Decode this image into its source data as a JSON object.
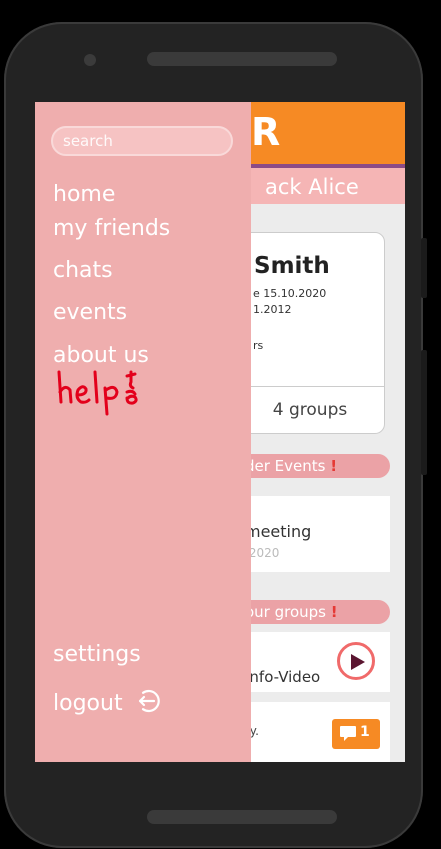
{
  "app": {
    "logo_letter": "R",
    "welcome_text": "ack Alice"
  },
  "drawer": {
    "search_placeholder": "search",
    "menu": [
      "home",
      "my friends",
      "chats",
      "events",
      "about us"
    ],
    "bottom_menu": [
      "settings",
      "logout"
    ],
    "handwritten_note": "help"
  },
  "profile_card": {
    "name": "Smith",
    "line1": "e 15.10.2020",
    "line2": "1.2012",
    "line3": "rs",
    "groups": "4 groups"
  },
  "sections": {
    "events_head": "der Events",
    "event_title": "meeting",
    "event_date": ".2020",
    "groups_head": "our groups",
    "video_title": "Info-Video",
    "chat_text": "ty.",
    "chat_count": "1",
    "alert_mark": "!"
  },
  "colors": {
    "topbar": "#f68a24",
    "drawer": "#efaeae",
    "welcome": "#f5b5b5",
    "accent_red": "#e53935",
    "play_ring": "#f06a6a"
  }
}
